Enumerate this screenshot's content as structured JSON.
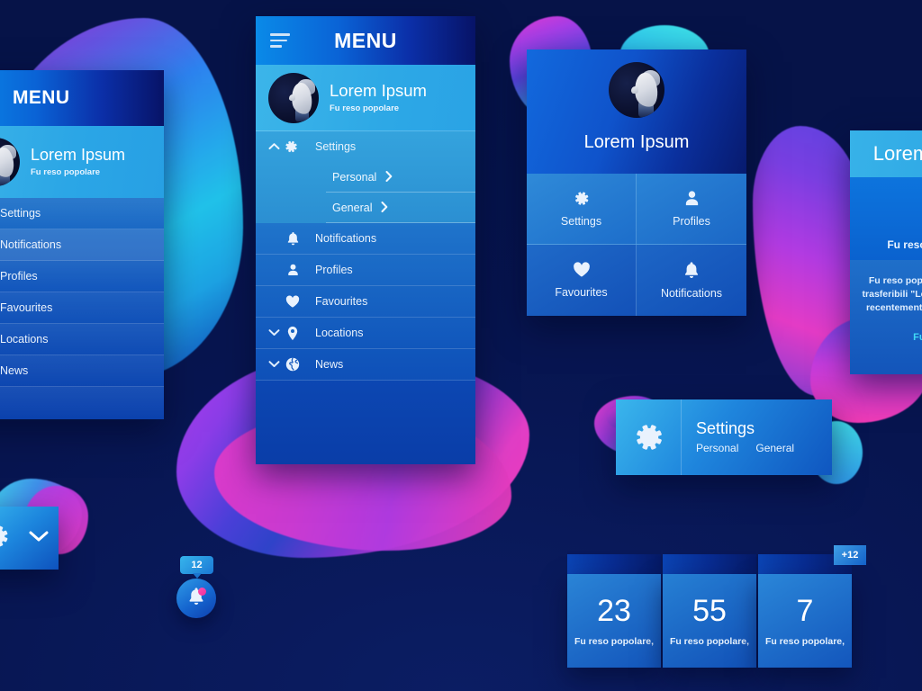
{
  "background": {
    "base_color": "#0a1a5e",
    "accent_cyan": "#2ec8ee",
    "accent_magenta": "#e43bc6",
    "accent_blue": "#0f56c0"
  },
  "left_menu": {
    "title": "MENU",
    "profile": {
      "name": "Lorem Ipsum",
      "subtitle": "Fu reso popolare"
    },
    "items": [
      {
        "label": "Settings",
        "active": false
      },
      {
        "label": "Notifications",
        "active": true
      },
      {
        "label": "Profiles",
        "active": false
      },
      {
        "label": "Favourites",
        "active": false
      },
      {
        "label": "Locations",
        "active": false
      },
      {
        "label": "News",
        "active": false
      }
    ]
  },
  "center_menu": {
    "title": "MENU",
    "menu_icon": "hamburger-icon",
    "profile": {
      "name": "Lorem Ipsum",
      "subtitle": "Fu reso popolare"
    },
    "settings_group": {
      "label": "Settings",
      "icon": "gear-icon",
      "chevron": "chevron-up-icon",
      "children": [
        {
          "label": "Personal",
          "arrow": "chevron-right-icon"
        },
        {
          "label": "General",
          "arrow": "chevron-right-icon"
        }
      ]
    },
    "items": [
      {
        "label": "Notifications",
        "icon": "bell-icon",
        "chevron": ""
      },
      {
        "label": "Profiles",
        "icon": "person-icon",
        "chevron": ""
      },
      {
        "label": "Favourites",
        "icon": "heart-icon",
        "chevron": ""
      },
      {
        "label": "Locations",
        "icon": "location-pin-icon",
        "chevron": "chevron-down-icon"
      },
      {
        "label": "News",
        "icon": "globe-icon",
        "chevron": "chevron-down-icon"
      }
    ]
  },
  "profile_card": {
    "name": "Lorem Ipsum",
    "avatar": "robot-face-avatar",
    "tiles": [
      {
        "label": "Settings",
        "icon": "gear-icon"
      },
      {
        "label": "Profiles",
        "icon": "person-icon"
      },
      {
        "label": "Favourites",
        "icon": "heart-icon"
      },
      {
        "label": "Notifications",
        "icon": "bell-icon"
      }
    ]
  },
  "right_card": {
    "title": "Lorem Ipsum",
    "subtitle": "Fu reso popolare",
    "body": "Fu reso popolare diffusione trasferibili \"Letraset\" passaggi recentemente impaginazione",
    "link": "Fu reso"
  },
  "settings_widget": {
    "icon": "gear-icon",
    "title": "Settings",
    "tabs": [
      "Personal",
      "General"
    ]
  },
  "gear_widget": {
    "icon": "gear-icon",
    "chevron": "chevron-down-icon"
  },
  "bell_button": {
    "icon": "bell-icon",
    "badge_count": "12",
    "has_alert_dot": true
  },
  "stats": {
    "badge": "+12",
    "cards": [
      {
        "value": "23",
        "caption": "Fu reso popolare,"
      },
      {
        "value": "55",
        "caption": "Fu reso popolare,"
      },
      {
        "value": "7",
        "caption": "Fu reso popolare,"
      }
    ]
  }
}
